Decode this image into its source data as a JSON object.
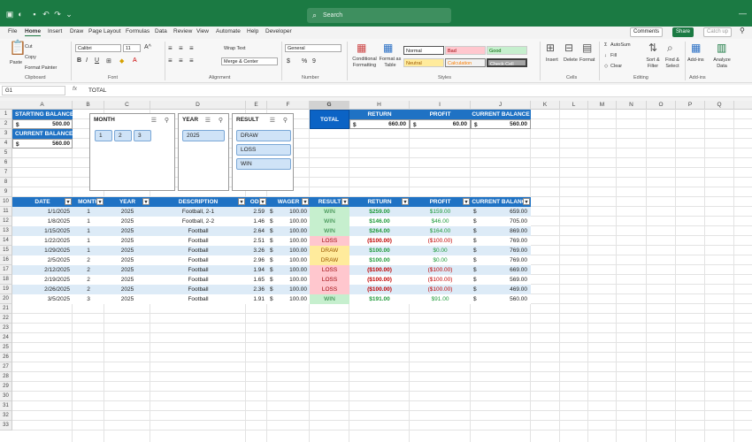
{
  "titlebar": {
    "search_placeholder": "Search"
  },
  "menubar": {
    "tabs": [
      "File",
      "Home",
      "Insert",
      "Draw",
      "Page Layout",
      "Formulas",
      "Data",
      "Review",
      "View",
      "Automate",
      "Help",
      "Developer"
    ],
    "comments": "Comments",
    "share": "Share",
    "catchup": "Catch up"
  },
  "ribbon": {
    "clipboard": {
      "paste": "Paste",
      "cut": "Cut",
      "copy": "Copy",
      "format_painter": "Format Painter",
      "label": "Clipboard"
    },
    "font": {
      "name": "Calibri",
      "size": "11",
      "label": "Font",
      "bold": "B",
      "italic": "I",
      "underline": "U"
    },
    "alignment": {
      "wrap_text": "Wrap Text",
      "merge_center": "Merge & Center",
      "label": "Alignment"
    },
    "number": {
      "format": "General",
      "currency": "$",
      "percent": "%",
      "comma": "9",
      "label": "Number"
    },
    "styles": {
      "conditional": "Conditional Formatting",
      "format_table": "Format as Table",
      "normal": "Normal",
      "bad": "Bad",
      "good": "Good",
      "neutral": "Neutral",
      "calculation": "Calculation",
      "check_cell": "Check Cell",
      "label": "Styles",
      "colors": {
        "normal": "#ffffff",
        "bad": "#ffc7ce",
        "good": "#c6efce",
        "neutral": "#ffeb9c",
        "calculation": "#f2f2f2",
        "check_cell": "#a5a5a5"
      }
    },
    "cells": {
      "insert": "Insert",
      "delete": "Delete",
      "format": "Format",
      "label": "Cells"
    },
    "editing": {
      "autosum": "AutoSum",
      "fill": "Fill",
      "clear": "Clear",
      "sort_filter": "Sort & Filter",
      "find_select": "Find & Select",
      "label": "Editing"
    },
    "addins": {
      "addins": "Add-ins",
      "analyze": "Analyze Data",
      "label": "Add-ins"
    }
  },
  "formula_bar": {
    "name_box": "G1",
    "fx": "fx",
    "formula": "TOTAL"
  },
  "columns": [
    "A",
    "B",
    "C",
    "D",
    "E",
    "F",
    "G",
    "H",
    "I",
    "J",
    "K",
    "L",
    "M",
    "N",
    "O",
    "P",
    "Q"
  ],
  "rows": [
    "1",
    "2",
    "3",
    "4",
    "5",
    "6",
    "7",
    "8",
    "9",
    "10",
    "11",
    "12",
    "13",
    "14",
    "15",
    "16",
    "17",
    "18",
    "19",
    "20",
    "21",
    "22",
    "23",
    "24",
    "25",
    "26",
    "27",
    "28",
    "29",
    "30",
    "31",
    "32",
    "33"
  ],
  "summary": {
    "starting_balance_label": "STARTING BALANCE",
    "starting_balance": "500.00",
    "current_balance_label": "CURRENT BALANCE",
    "current_balance": "560.00",
    "currency": "$",
    "total_label": "TOTAL",
    "return_label": "RETURN",
    "profit_label": "PROFIT",
    "curbal_label": "CURRENT BALANCE",
    "return_value": "660.00",
    "profit_value": "60.00",
    "curbal_value": "560.00"
  },
  "slicers": {
    "month": {
      "title": "MONTH",
      "items": [
        "1",
        "2",
        "3"
      ]
    },
    "year": {
      "title": "YEAR",
      "items": [
        "2025"
      ]
    },
    "result": {
      "title": "RESULT",
      "items": [
        "DRAW",
        "LOSS",
        "WIN"
      ]
    }
  },
  "table": {
    "headers": [
      "DATE",
      "MONTH",
      "YEAR",
      "DESCRIPTION",
      "ODD",
      "WAGER",
      "RESULT",
      "RETURN",
      "PROFIT",
      "CURRENT BALANCE"
    ],
    "currency": "$",
    "rows": [
      {
        "date": "1/1/2025",
        "month": "1",
        "year": "2025",
        "desc": "Football, 2-1",
        "odd": "2.59",
        "wager": "100.00",
        "result": "WIN",
        "ret": "$259.00",
        "profit": "$159.00",
        "bal": "659.00"
      },
      {
        "date": "1/8/2025",
        "month": "1",
        "year": "2025",
        "desc": "Football, 2-2",
        "odd": "1.46",
        "wager": "100.00",
        "result": "WIN",
        "ret": "$146.00",
        "profit": "$46.00",
        "bal": "705.00"
      },
      {
        "date": "1/15/2025",
        "month": "1",
        "year": "2025",
        "desc": "Football",
        "odd": "2.64",
        "wager": "100.00",
        "result": "WIN",
        "ret": "$264.00",
        "profit": "$164.00",
        "bal": "869.00"
      },
      {
        "date": "1/22/2025",
        "month": "1",
        "year": "2025",
        "desc": "Football",
        "odd": "2.51",
        "wager": "100.00",
        "result": "LOSS",
        "ret": "($100.00)",
        "profit": "($100.00)",
        "bal": "769.00"
      },
      {
        "date": "1/29/2025",
        "month": "1",
        "year": "2025",
        "desc": "Football",
        "odd": "3.26",
        "wager": "100.00",
        "result": "DRAW",
        "ret": "$100.00",
        "profit": "$0.00",
        "bal": "769.00"
      },
      {
        "date": "2/5/2025",
        "month": "2",
        "year": "2025",
        "desc": "Football",
        "odd": "2.96",
        "wager": "100.00",
        "result": "DRAW",
        "ret": "$100.00",
        "profit": "$0.00",
        "bal": "769.00"
      },
      {
        "date": "2/12/2025",
        "month": "2",
        "year": "2025",
        "desc": "Football",
        "odd": "1.94",
        "wager": "100.00",
        "result": "LOSS",
        "ret": "($100.00)",
        "profit": "($100.00)",
        "bal": "669.00"
      },
      {
        "date": "2/19/2025",
        "month": "2",
        "year": "2025",
        "desc": "Football",
        "odd": "1.65",
        "wager": "100.00",
        "result": "LOSS",
        "ret": "($100.00)",
        "profit": "($100.00)",
        "bal": "569.00"
      },
      {
        "date": "2/26/2025",
        "month": "2",
        "year": "2025",
        "desc": "Football",
        "odd": "2.36",
        "wager": "100.00",
        "result": "LOSS",
        "ret": "($100.00)",
        "profit": "($100.00)",
        "bal": "469.00"
      },
      {
        "date": "3/5/2025",
        "month": "3",
        "year": "2025",
        "desc": "Football",
        "odd": "1.91",
        "wager": "100.00",
        "result": "WIN",
        "ret": "$191.00",
        "profit": "$91.00",
        "bal": "560.00"
      }
    ]
  },
  "colors": {
    "excel_green": "#1b7a43",
    "header_blue": "#1f72c4",
    "row_band": "#ddebf7",
    "win_fill": "#c6efce",
    "win_text": "#1e7a33",
    "loss_fill": "#ffc7ce",
    "loss_text": "#9c0006",
    "draw_fill": "#ffeb9c",
    "draw_text": "#9c5700",
    "profit_green": "#1e9a3a",
    "profit_red": "#c00000"
  }
}
